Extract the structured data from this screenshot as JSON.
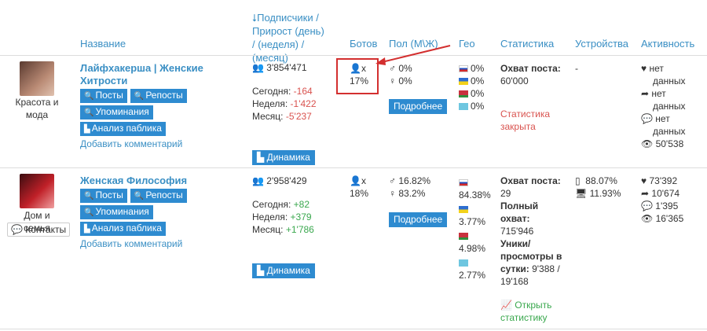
{
  "headers": {
    "name": "Название",
    "subs": "⭣Подписчики / Прирост (день) / (неделя) / (месяц)",
    "subs_l1": "⭣Подписчики /",
    "subs_l2": "Прирост (день)",
    "subs_l3": "/ (неделя) / (месяц)",
    "bots": "Ботов",
    "gender": "Пол (М\\Ж)",
    "geo": "Гео",
    "stats": "Статистика",
    "devices": "Устройства",
    "activity": "Активность"
  },
  "rows": [
    {
      "category_l1": "Красота и",
      "category_l2": "мода",
      "title_l1": "Лайфхакерша | Женские",
      "title_l2": "Хитрости",
      "btn_posts": "Посты",
      "btn_reposts": "Репосты",
      "btn_mentions": "Упоминания",
      "btn_analysis": "Анализ паблика",
      "add_comment": "Добавить комментарий",
      "subscribers": "3'854'471",
      "today_label": "Сегодня:",
      "today": "-164",
      "week_label": "Неделя:",
      "week": "-1'422",
      "month_label": "Месяц:",
      "month": "-5'237",
      "dynamics": "Динамика",
      "bots": "17%",
      "male": "0%",
      "female": "0%",
      "details": "Подробнее",
      "geo_ru": "0%",
      "geo_ua": "0%",
      "geo_by": "0%",
      "geo_kz": "0%",
      "reach_label": "Охват поста:",
      "reach": "60'000",
      "stats_closed_l1": "Статистика",
      "stats_closed_l2": "закрыта",
      "devices": "-",
      "likes": "нет",
      "likes_2": "данных",
      "shares": "нет",
      "shares_2": "данных",
      "comments": "нет",
      "comments_2": "данных",
      "views": "50'538"
    },
    {
      "category": "Дом и семья",
      "contacts": "Контакты",
      "title": "Женская Философия",
      "btn_posts": "Посты",
      "btn_reposts": "Репосты",
      "btn_mentions": "Упоминания",
      "btn_analysis": "Анализ паблика",
      "add_comment": "Добавить комментарий",
      "subscribers": "2'958'429",
      "today_label": "Сегодня:",
      "today": "+82",
      "week_label": "Неделя:",
      "week": "+379",
      "month_label": "Месяц:",
      "month": "+1'786",
      "dynamics": "Динамика",
      "bots": "18%",
      "male": "16.82%",
      "female": "83.2%",
      "details": "Подробнее",
      "geo_ru": "84.38%",
      "geo_ua": "3.77%",
      "geo_by": "4.98%",
      "geo_kz": "2.77%",
      "reach_label": "Охват поста:",
      "reach": "29",
      "full_reach_l1": "Полный",
      "full_reach_l2": "охват:",
      "full_reach": "715'946",
      "uniq_l1": "Уники/",
      "uniq_l2": "просмотры в",
      "uniq_l3": "сутки:",
      "uniq_v1": "9'388 /",
      "uniq_v2": "19'168",
      "open_stats_l1": "Открыть",
      "open_stats_l2": "статистику",
      "mobile": "88.07%",
      "desktop": "11.93%",
      "likes": "73'392",
      "shares": "10'674",
      "comments": "1'395",
      "views": "16'365"
    }
  ],
  "colors": {
    "link": "#3a8fc4",
    "button": "#2e8bd0",
    "negative": "#d9534f",
    "positive": "#3aa84e",
    "highlight": "#d32f2f"
  }
}
